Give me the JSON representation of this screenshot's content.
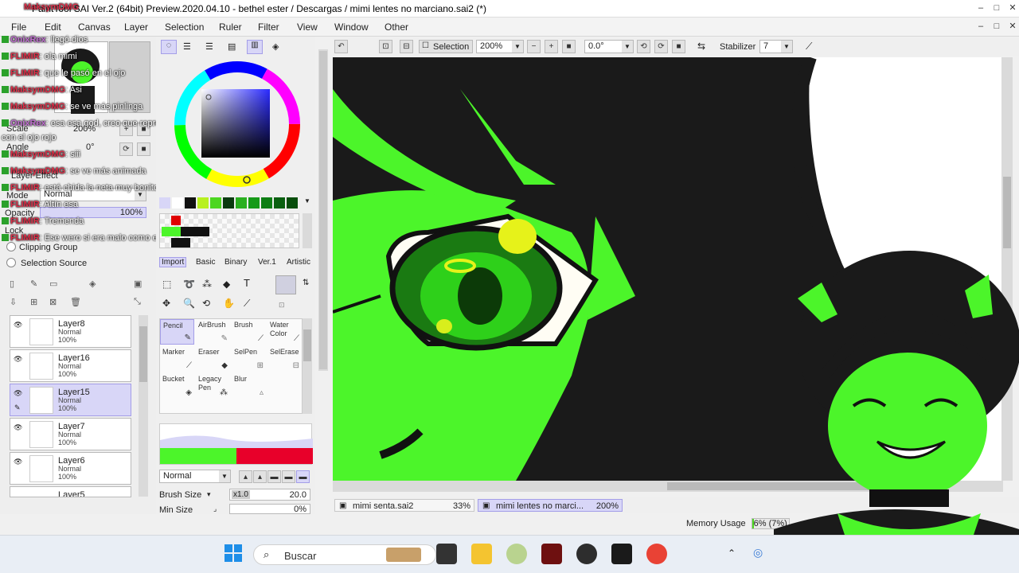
{
  "window": {
    "title": "PaintTool SAI Ver.2 (64bit) Preview.2020.04.10 - bethel ester / Descargas / mimi lentes no marciano.sai2 (*)"
  },
  "menu": [
    "File",
    "Edit",
    "Canvas",
    "Layer",
    "Selection",
    "Ruler",
    "Filter",
    "View",
    "Window",
    "Other"
  ],
  "toolbar": {
    "selection_label": "Selection",
    "zoom": "200%",
    "rotation": "0.0°",
    "stabilizer_label": "Stabilizer",
    "stabilizer_value": "7"
  },
  "leftpanel": {
    "scale_label": "Scale",
    "scale_value": "200%",
    "angle_label": "Angle",
    "angle_value": "0°",
    "layer_effect": "Layer Effect",
    "mode_label": "Mode",
    "mode_value": "Normal",
    "opacity_label": "Opacity",
    "opacity_value": "100%",
    "lock_label": "Lock",
    "clipping_group": "Clipping Group",
    "selection_source": "Selection Source"
  },
  "layers": [
    {
      "name": "Layer8",
      "mode": "Normal",
      "opacity": "100%"
    },
    {
      "name": "Layer16",
      "mode": "Normal",
      "opacity": "100%"
    },
    {
      "name": "Layer15",
      "mode": "Normal",
      "opacity": "100%"
    },
    {
      "name": "Layer7",
      "mode": "Normal",
      "opacity": "100%"
    },
    {
      "name": "Layer6",
      "mode": "Normal",
      "opacity": "100%"
    },
    {
      "name": "Layer5"
    }
  ],
  "chat": [
    {
      "user": "MaksymDMG",
      "msg": ""
    },
    {
      "user": "OnixRex",
      "msg": ": llegó dios"
    },
    {
      "user": "FLIMIR",
      "msg": ": ola mimi"
    },
    {
      "user": "FLIMIR",
      "msg": ": que le pasó en el ojo"
    },
    {
      "user": "MaksymDMG",
      "msg": ": Asi"
    },
    {
      "user": "MaksymDMG",
      "msg": ": se ve más pinlinga"
    },
    {
      "user": "OnixRex",
      "msg": ": esa esa god, creo que representa bien lo que quería representar"
    },
    {
      "user": "",
      "msg": "con el ojo rojo"
    },
    {
      "user": "MaksymDMG",
      "msg": ": siii"
    },
    {
      "user": "MaksymDMG",
      "msg": ": se ve más animada"
    },
    {
      "user": "FLIMIR",
      "msg": ": está chida la neta muy bonito"
    },
    {
      "user": "FLIMIR",
      "msg": ": Altín esa"
    },
    {
      "user": "FLIMIR",
      "msg": ": Tremenda"
    },
    {
      "user": "FLIMIR",
      "msg": ": Ese wero si era malo como el diablo"
    }
  ],
  "palette_tabs": [
    "Import",
    "Basic",
    "Binary",
    "Ver.1",
    "Artistic"
  ],
  "tools": [
    {
      "label": "Pencil",
      "sub": ""
    },
    {
      "label": "AirBrush",
      "sub": ""
    },
    {
      "label": "Brush",
      "sub": ""
    },
    {
      "label": "Water",
      "sub": "Color"
    },
    {
      "label": "Marker",
      "sub": ""
    },
    {
      "label": "Eraser",
      "sub": ""
    },
    {
      "label": "SelPen",
      "sub": ""
    },
    {
      "label": "SelErase",
      "sub": ""
    },
    {
      "label": "Bucket",
      "sub": ""
    },
    {
      "label": "Legacy",
      "sub": "Pen"
    },
    {
      "label": "Blur",
      "sub": ""
    }
  ],
  "brush": {
    "mode": "Normal",
    "size_label": "Brush Size",
    "size_mult": "x1.0",
    "size_value": "20.0",
    "min_label": "Min Size",
    "min_value": "0%"
  },
  "documents": [
    {
      "name": "mimi senta.sai2",
      "zoom": "33%"
    },
    {
      "name": "mimi lentes no marci...",
      "zoom": "200%"
    }
  ],
  "memory": {
    "label": "Memory Usage",
    "value": "6% (7%)"
  },
  "taskbar": {
    "search_placeholder": "Buscar"
  },
  "colors": {
    "accent": "#d8d6f7",
    "green": "#4cf52a",
    "dark": "#1a1a1a"
  }
}
